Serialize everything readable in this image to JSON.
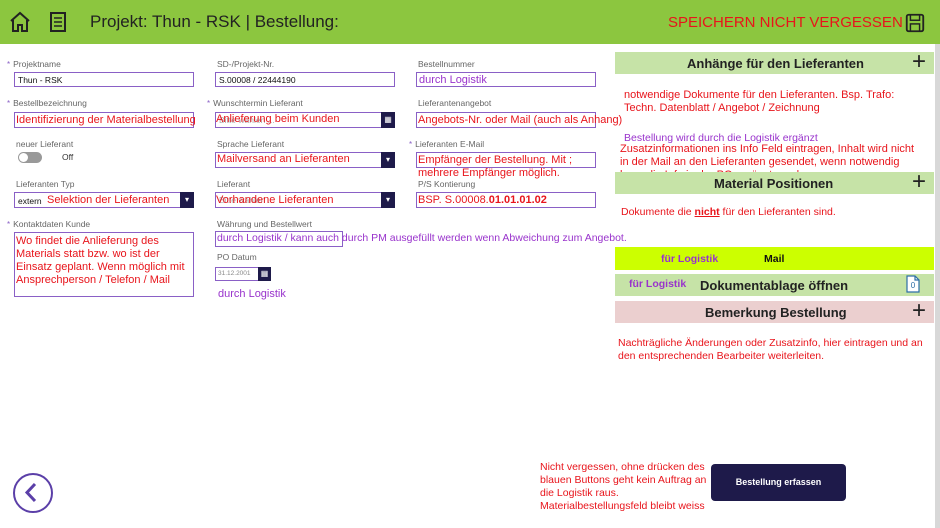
{
  "header": {
    "title": "Projekt: Thun - RSK | Bestellung:",
    "save_warning": "SPEICHERN NICHT VERGESSEN"
  },
  "fields": {
    "projektname": {
      "label": "Projektname",
      "value": "Thun - RSK"
    },
    "sd_projekt_nr": {
      "label": "SD-/Projekt-Nr.",
      "value": "S.00008 / 22444190"
    },
    "bestellnummer": {
      "label": "Bestellnummer",
      "value": "durch Logistik"
    },
    "bestellbezeichnung": {
      "label": "Bestellbezeichnung",
      "value": "Identifizierung der Materialbestellung"
    },
    "wunschtermin": {
      "label": "Wunschtermin Lieferant",
      "placeholder": "Bitte wählen ...",
      "overlay": "Anlieferung beim Kunden"
    },
    "lieferantenangebot": {
      "label": "Lieferantenangebot",
      "value": "Angebots-Nr. oder Mail (auch als Anhang)"
    },
    "neuer_lieferant": {
      "label": "neuer Lieferant",
      "toggle_text": "Off"
    },
    "sprache_lieferant": {
      "label": "Sprache Lieferant",
      "value": "Mailversand an Lieferanten"
    },
    "lieferanten_email": {
      "label": "Lieferanten E-Mail",
      "value": "Empfänger der Bestellung. Mit ; mehrere Empfänger möglich."
    },
    "lieferanten_typ": {
      "label": "Lieferanten Typ",
      "prefix": "extern",
      "value": "Selektion der Lieferanten"
    },
    "lieferant": {
      "label": "Lieferant",
      "placeholder": "Bitte wählen ...",
      "value": "Vorhandene Lieferanten"
    },
    "ps_kontierung": {
      "label": "P/S Kontierung",
      "value_prefix": "BSP. S.00008.",
      "value_bold": "01.01.01.02"
    },
    "kontaktdaten": {
      "label": "Kontaktdaten Kunde",
      "value": "Wo findet die Anlieferung des Materials statt bzw. wo ist der Einsatz geplant. Wenn möglich mit Ansprechperson / Telefon / Mail"
    },
    "waehrung": {
      "label": "Währung und Bestellwert",
      "value": "durch Logistik / kann auch durch PM ausgefüllt werden wenn Abweichung zum Angebot."
    },
    "po_datum": {
      "label": "PO Datum",
      "value": "31.12.2001",
      "note": "durch Logistik"
    }
  },
  "right": {
    "anhaenge": {
      "title": "Anhänge für den Lieferanten",
      "text": "notwendige Dokumente für den Lieferanten. Bsp. Trafo: Techn. Datenblatt / Angebot / Zeichnung",
      "note": "Bestellung wird durch die Logistik ergänzt"
    },
    "zusatz": "Zusatzinformationen ins Info Feld eintragen, Inhalt wird nicht in der Mail an den Lieferanten gesendet, wenn notwendig kann die Info in der PO ergänzt werden.",
    "material": {
      "title": "Material Positionen",
      "text_before": "Dokumente die ",
      "text_underline": "nicht",
      "text_after": " für den Lieferanten sind."
    },
    "mail_bar": {
      "left": "für Logistik",
      "right": "Mail"
    },
    "dokumentablage": {
      "left": "für Logistik",
      "title": "Dokumentablage öffnen",
      "count": "0"
    },
    "bemerkung": {
      "title": "Bemerkung Bestellung",
      "text": "Nachträgliche Änderungen oder Zusatzinfo, hier eintragen und an den entsprechenden Bearbeiter weiterleiten."
    }
  },
  "footer": {
    "warning": "Nicht vergessen, ohne drücken des blauen Buttons geht kein Auftrag an die Logistik raus. Materialbestellungsfeld bleibt weiss",
    "submit_label": "Bestellung erfassen"
  },
  "colors": {
    "header": "#8cc63f",
    "accent": "#1e1a4a",
    "section": "#c6e3a7",
    "lime": "#ccff00",
    "pink": "#ebcfcf",
    "red": "#e8141b"
  }
}
